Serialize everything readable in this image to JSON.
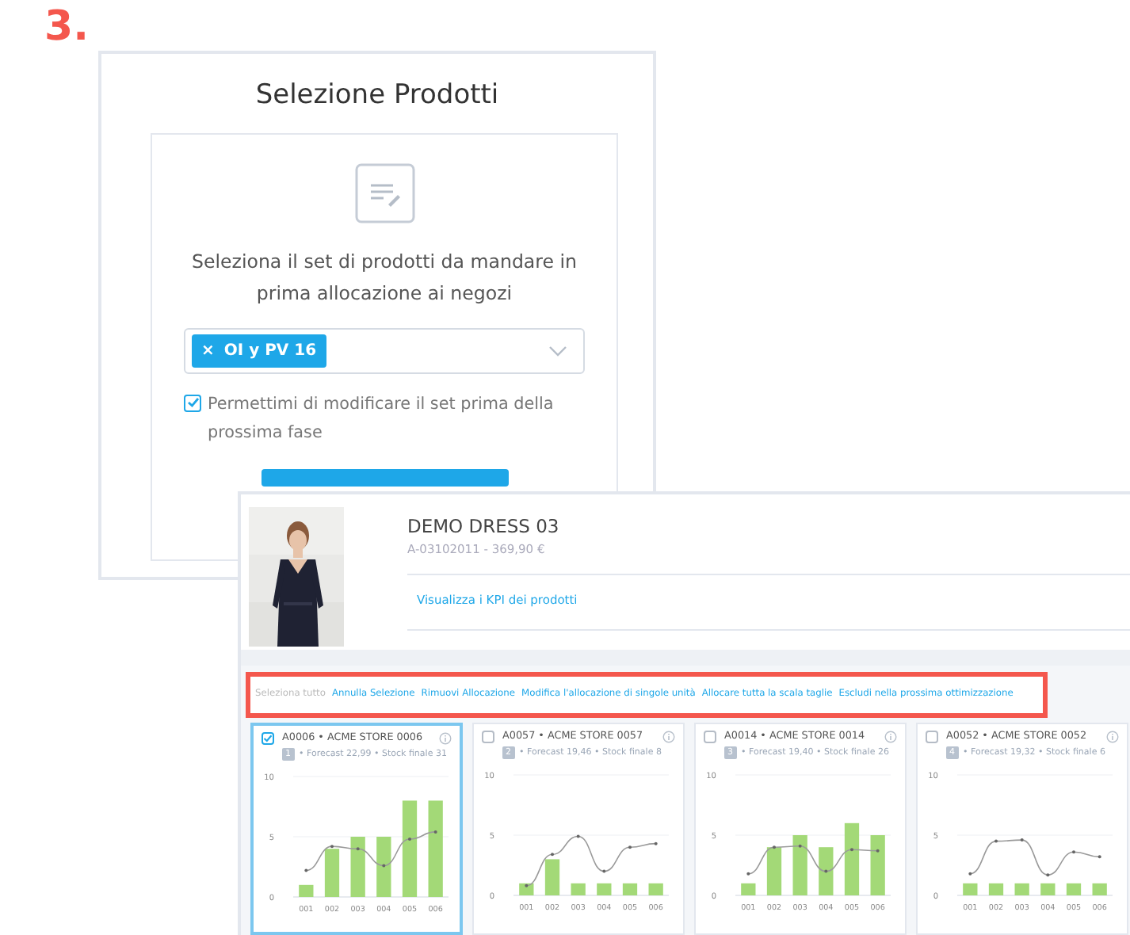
{
  "step_label": "3.",
  "wizard": {
    "title": "Selezione Prodotti",
    "prompt": "Seleziona il set di prodotti da mandare in prima allocazione ai negozi",
    "selected_tags": [
      {
        "remove": "×",
        "label": "OI y PV 16"
      }
    ],
    "allow_edit": {
      "label": "Permettimi di modificare il set prima della prossima fase",
      "checked": true
    }
  },
  "product": {
    "name": "DEMO DRESS 03",
    "code_price": "A-03102011 - 369,90 €",
    "kpi_link": "Visualizza i KPI dei prodotti"
  },
  "actions": [
    {
      "label": "Seleziona tutto",
      "disabled": true
    },
    {
      "label": "Annulla Selezione",
      "disabled": false
    },
    {
      "label": "Rimuovi Allocazione",
      "disabled": false
    },
    {
      "label": "Modifica l'allocazione di singole unità",
      "disabled": false
    },
    {
      "label": "Allocare tutta la scala taglie",
      "disabled": false
    },
    {
      "label": "Escludi nella prossima ottimizzazione",
      "disabled": false
    }
  ],
  "stores": [
    {
      "title": "A0006 • ACME STORE 0006",
      "rank": "1",
      "stats": "• Forecast 22,99 • Stock finale 31",
      "selected": true,
      "chart_data": {
        "type": "bar",
        "categories": [
          "001",
          "002",
          "003",
          "004",
          "005",
          "006"
        ],
        "yticks": [
          0,
          5,
          10
        ],
        "ylim": [
          0,
          10
        ],
        "series": [
          {
            "color": "#a3d977",
            "values": [
              1,
              4,
              5,
              5,
              8,
              8
            ]
          },
          {
            "color": "#9a9a9a",
            "type": "line",
            "values": [
              2.2,
              4.2,
              4,
              2.6,
              4.8,
              5.4
            ]
          }
        ]
      }
    },
    {
      "title": "A0057 • ACME STORE 0057",
      "rank": "2",
      "stats": "• Forecast 19,46 • Stock finale 8",
      "selected": false,
      "chart_data": {
        "type": "bar",
        "categories": [
          "001",
          "002",
          "003",
          "004",
          "005",
          "006"
        ],
        "yticks": [
          0,
          5,
          10
        ],
        "ylim": [
          0,
          10
        ],
        "series": [
          {
            "color": "#a3d977",
            "values": [
              1,
              3,
              1,
              1,
              1,
              1
            ]
          },
          {
            "color": "#9a9a9a",
            "type": "line",
            "values": [
              0.8,
              3.4,
              4.9,
              2,
              4,
              4.3
            ]
          }
        ]
      }
    },
    {
      "title": "A0014 • ACME STORE 0014",
      "rank": "3",
      "stats": "• Forecast 19,40 • Stock finale 26",
      "selected": false,
      "chart_data": {
        "type": "bar",
        "categories": [
          "001",
          "002",
          "003",
          "004",
          "005",
          "006"
        ],
        "yticks": [
          0,
          5,
          10
        ],
        "ylim": [
          0,
          10
        ],
        "series": [
          {
            "color": "#a3d977",
            "values": [
              1,
              4,
              5,
              4,
              6,
              5
            ]
          },
          {
            "color": "#9a9a9a",
            "type": "line",
            "values": [
              1.8,
              4,
              4.1,
              2,
              3.8,
              3.7
            ]
          }
        ]
      }
    },
    {
      "title": "A0052 • ACME STORE 0052",
      "rank": "4",
      "stats": "• Forecast 19,32 • Stock finale 6",
      "selected": false,
      "chart_data": {
        "type": "bar",
        "categories": [
          "001",
          "002",
          "003",
          "004",
          "005",
          "006"
        ],
        "yticks": [
          0,
          5,
          10
        ],
        "ylim": [
          0,
          10
        ],
        "series": [
          {
            "color": "#a3d977",
            "values": [
              1,
              1,
              1,
              1,
              1,
              1
            ]
          },
          {
            "color": "#9a9a9a",
            "type": "line",
            "values": [
              1.8,
              4.5,
              4.6,
              1.7,
              3.6,
              3.2
            ]
          }
        ]
      }
    }
  ]
}
